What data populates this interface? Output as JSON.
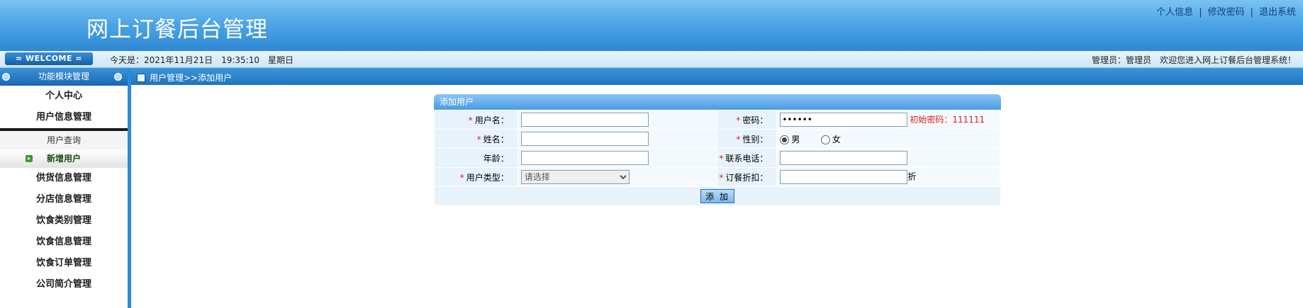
{
  "header": {
    "title": "网上订餐后台管理",
    "links": [
      "个人信息",
      "修改密码",
      "退出系统"
    ],
    "link_separator": "|"
  },
  "infobar": {
    "welcome": "= WELCOME =",
    "date_text": "今天是：2021年11月21日　19:35:10　星期日",
    "admin_text": "管理员：管理员　欢迎您进入网上订餐后台管理系统！"
  },
  "sidebar": {
    "title": "功能模块管理",
    "items_top": [
      "个人中心",
      "用户信息管理"
    ],
    "sub_items": [
      "用户查询",
      "新增用户"
    ],
    "items_bottom": [
      "供货信息管理",
      "分店信息管理",
      "饮食类别管理",
      "饮食信息管理",
      "饮食订单管理",
      "公司简介管理"
    ]
  },
  "breadcrumb": "用户管理>>添加用户",
  "form": {
    "title": "添加用户",
    "required_mark": "*",
    "username_label": "用户名：",
    "username_value": "",
    "password_label": "密码：",
    "password_value": "111111",
    "password_hint": "初始密码：111111",
    "name_label": "姓名：",
    "name_value": "",
    "gender_label": "性别：",
    "gender_options": [
      "男",
      "女"
    ],
    "gender_selected": "男",
    "age_label": "年龄：",
    "age_value": "",
    "phone_label": "联系电话：",
    "phone_value": "",
    "usertype_label": "用户类型：",
    "usertype_selected": "请选择",
    "discount_label": "订餐折扣：",
    "discount_value": "",
    "discount_unit": "折",
    "submit_label": "添 加"
  },
  "colors": {
    "header_blue": "#4ea6e6",
    "sidebar_border": "#2c8bd6",
    "required_red": "#e0201e"
  }
}
